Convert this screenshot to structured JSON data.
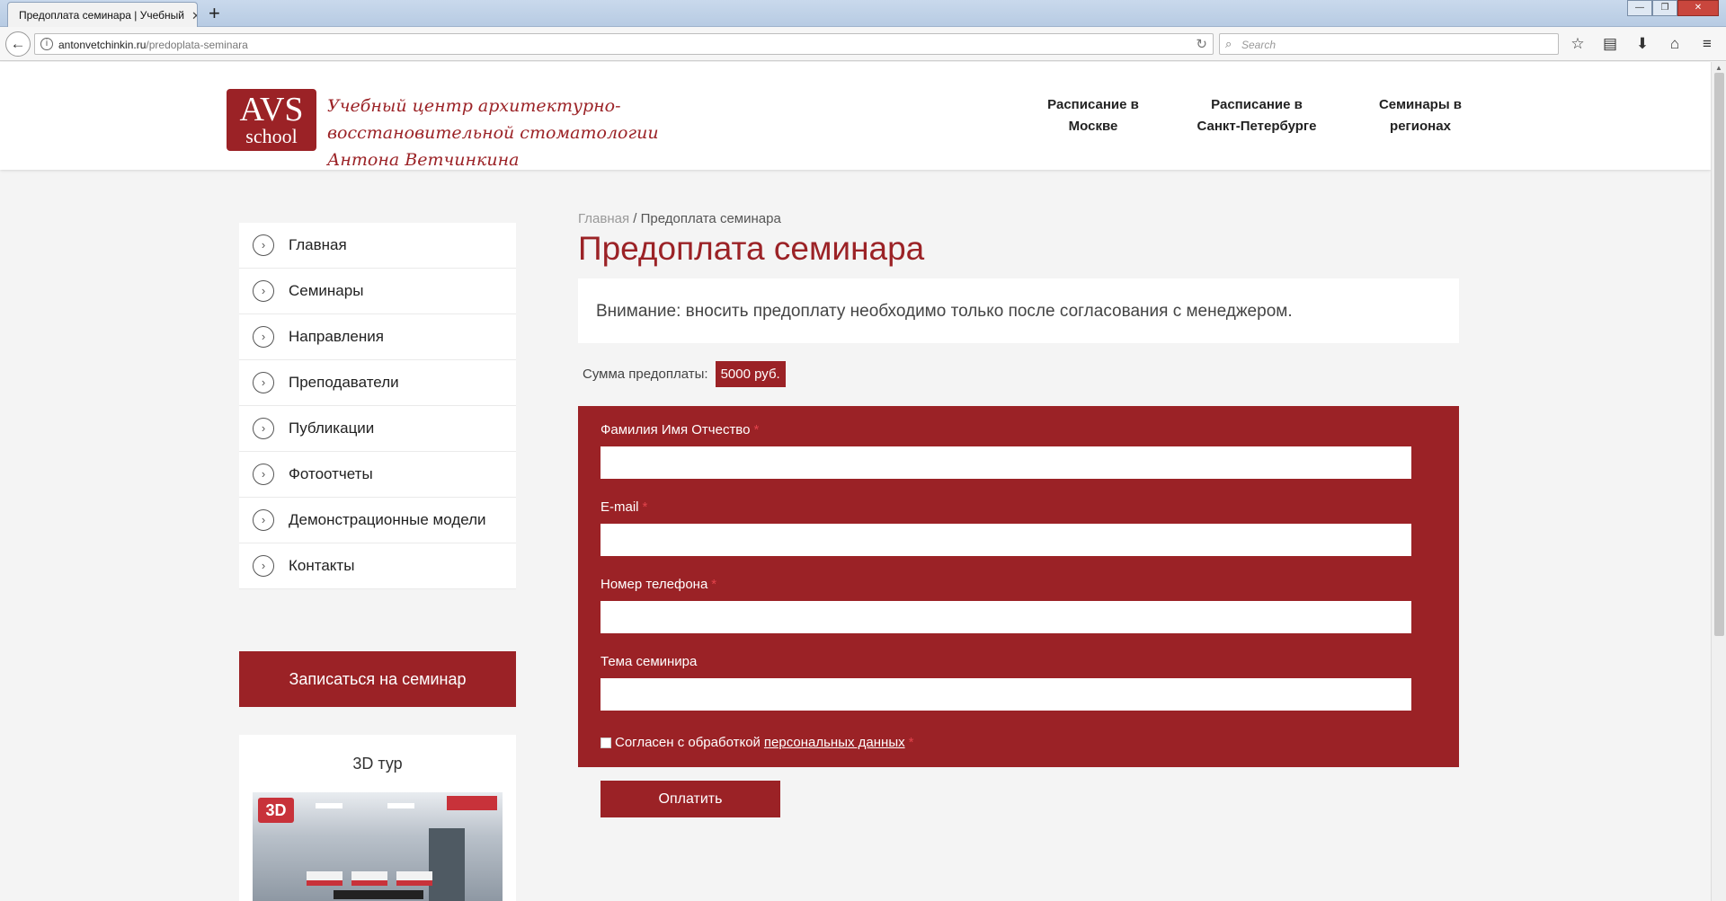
{
  "browser": {
    "tab_title": "Предоплата семинара | Учебный",
    "tab_close": "✕",
    "new_tab": "+",
    "window_controls": [
      "—",
      "❐",
      "✕"
    ],
    "back": "←",
    "url_host": "antonvetchinkin.ru",
    "url_path": "/predoplata-seminara",
    "search_placeholder": "Search",
    "toolbar_icons": [
      "star-icon",
      "reading-list-icon",
      "download-icon",
      "home-icon",
      "menu-icon"
    ],
    "toolbar_glyphs": [
      "☆",
      "▤",
      "⬇",
      "⌂",
      "≡"
    ]
  },
  "header": {
    "logo_line1": "AVS",
    "logo_line2": "school",
    "tagline": "Учебный центр архитектурно-восстановительной стоматологии Антона Ветчинкина",
    "nav": [
      {
        "line1": "Расписание в",
        "line2": "Москве"
      },
      {
        "line1": "Расписание в",
        "line2": "Санкт-Петербурге"
      },
      {
        "line1": "Семинары в",
        "line2": "регионах"
      }
    ]
  },
  "sidebar": {
    "items": [
      {
        "label": "Главная"
      },
      {
        "label": "Семинары"
      },
      {
        "label": "Направления"
      },
      {
        "label": "Преподаватели"
      },
      {
        "label": "Публикации"
      },
      {
        "label": "Фотоотчеты"
      },
      {
        "label": "Демонстрационные модели"
      },
      {
        "label": "Контакты"
      }
    ],
    "signup_label": "Записаться на семинар",
    "tour_title": "3D тур",
    "tour_badge": "3D"
  },
  "main": {
    "breadcrumb_home": "Главная",
    "breadcrumb_sep": "/",
    "breadcrumb_current": "Предоплата семинара",
    "title": "Предоплата семинара",
    "notice": "Внимание: вносить предоплату необходимо только после согласования с менеджером.",
    "amount_label": "Сумма предоплаты:",
    "amount_value": "5000 руб.",
    "form": {
      "fields": [
        {
          "label": "Фамилия Имя Отчество",
          "required": "*",
          "value": ""
        },
        {
          "label": "E-mail",
          "required": "*",
          "value": ""
        },
        {
          "label": "Номер телефона",
          "required": "*",
          "value": ""
        },
        {
          "label": "Тема семинира",
          "required": "",
          "value": ""
        }
      ],
      "consent_text": "Согласен с обработкой",
      "consent_link": "персональных данных",
      "consent_required": "*",
      "consent_checked": false
    },
    "pay_label": "Оплатить"
  },
  "colors": {
    "brand": "#9b2226",
    "background": "#f4f4f4"
  }
}
